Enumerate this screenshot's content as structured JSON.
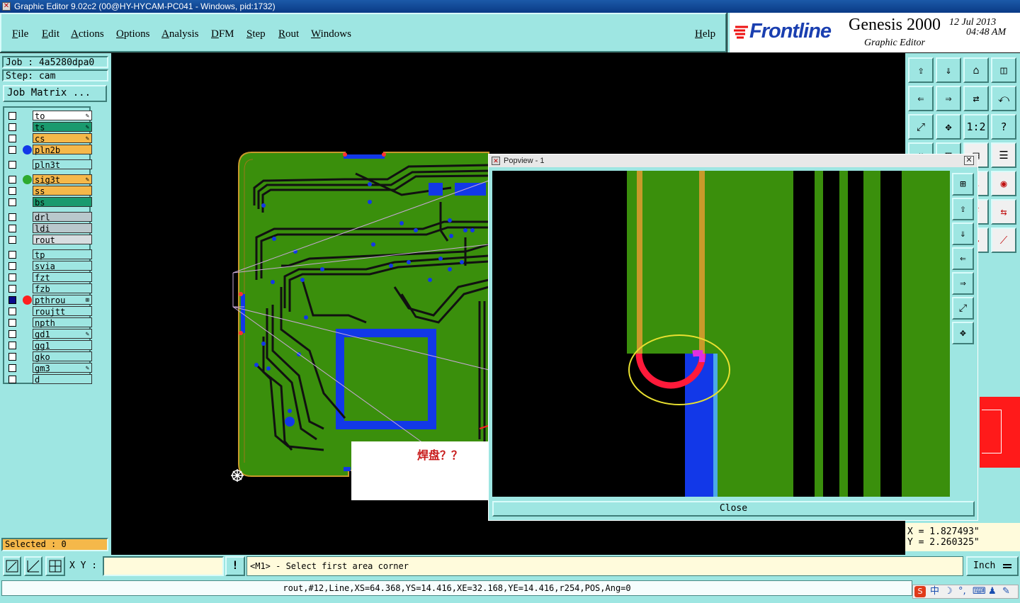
{
  "window": {
    "title": "Graphic Editor 9.02c2 (00@HY-HYCAM-PC041 - Windows, pid:1732)"
  },
  "menu": {
    "items": [
      "File",
      "Edit",
      "Actions",
      "Options",
      "Analysis",
      "DFM",
      "Step",
      "Rout",
      "Windows"
    ],
    "help": "Help"
  },
  "logo": {
    "brand": "Frontline",
    "product": "Genesis 2000",
    "subtitle": "Graphic Editor",
    "date": "12 Jul 2013",
    "time": "04:48 AM"
  },
  "job": {
    "job_line": "Job : 4a5280dpa0",
    "step_line": "Step: cam",
    "matrix_button": "Job Matrix ..."
  },
  "layers": [
    {
      "name": "to",
      "color": "#ffffff",
      "flag": "✎",
      "dot": ""
    },
    {
      "name": "ts",
      "color": "#1a9a6e",
      "flag": "✎",
      "dot": ""
    },
    {
      "name": "cs",
      "color": "#f5b84a",
      "flag": "✎",
      "dot": ""
    },
    {
      "name": "pln2b",
      "color": "#f5b84a",
      "flag": "",
      "dot": "#1238e8"
    },
    {
      "name": "pln3t",
      "color": "#9ee6e2",
      "flag": "",
      "dot": ""
    },
    {
      "name": "sig3t",
      "color": "#f5b84a",
      "flag": "✎",
      "dot": "#2eaa2e"
    },
    {
      "name": "ss",
      "color": "#f5b84a",
      "flag": "",
      "dot": ""
    },
    {
      "name": "bs",
      "color": "#1a9a6e",
      "flag": "",
      "dot": ""
    },
    {
      "name": "drl",
      "color": "#b9c8cc",
      "flag": "",
      "dot": ""
    },
    {
      "name": "ldi",
      "color": "#b9c8cc",
      "flag": "",
      "dot": ""
    },
    {
      "name": "rout",
      "color": "#d7dde0",
      "flag": "",
      "dot": ""
    },
    {
      "name": "tp",
      "color": "#9ee6e2",
      "flag": "",
      "dot": ""
    },
    {
      "name": "svia",
      "color": "#9ee6e2",
      "flag": "",
      "dot": ""
    },
    {
      "name": "fzt",
      "color": "#9ee6e2",
      "flag": "",
      "dot": ""
    },
    {
      "name": "fzb",
      "color": "#9ee6e2",
      "flag": "",
      "dot": ""
    },
    {
      "name": "pthrou",
      "color": "#9ee6e2",
      "flag": "⊞",
      "dot": "#ff2020"
    },
    {
      "name": "roujtt",
      "color": "#9ee6e2",
      "flag": "",
      "dot": ""
    },
    {
      "name": "npth",
      "color": "#9ee6e2",
      "flag": "",
      "dot": ""
    },
    {
      "name": "gd1",
      "color": "#9ee6e2",
      "flag": "✎",
      "dot": ""
    },
    {
      "name": "gg1",
      "color": "#9ee6e2",
      "flag": "",
      "dot": ""
    },
    {
      "name": "gko",
      "color": "#9ee6e2",
      "flag": "",
      "dot": ""
    },
    {
      "name": "gm3",
      "color": "#9ee6e2",
      "flag": "✎",
      "dot": ""
    },
    {
      "name": "d",
      "color": "#9ee6e2",
      "flag": "",
      "dot": ""
    }
  ],
  "selected": "Selected : 0",
  "annotation": {
    "text": "焊盘？？"
  },
  "popview": {
    "title": "Popview - 1",
    "close_label": "Close"
  },
  "coords": {
    "x": "X = 1.827493\"",
    "y": "Y = 2.260325\""
  },
  "bottom": {
    "xy_label": "X Y :",
    "xy_value": "",
    "prompt": "<M1> - Select first area corner",
    "units": "Inch"
  },
  "status": "rout,#12,Line,XS=64.368,YS=14.416,XE=32.168,YE=14.416,r254,POS,Ang=0",
  "tray": {
    "ime": "中",
    "icons": [
      "S",
      "中",
      "☽",
      "°,",
      "⌨",
      "♟",
      "✎"
    ]
  },
  "colors": {
    "panel": "#9ee6e2",
    "board": "#3a8f0c",
    "copper_blue": "#1238e8"
  }
}
